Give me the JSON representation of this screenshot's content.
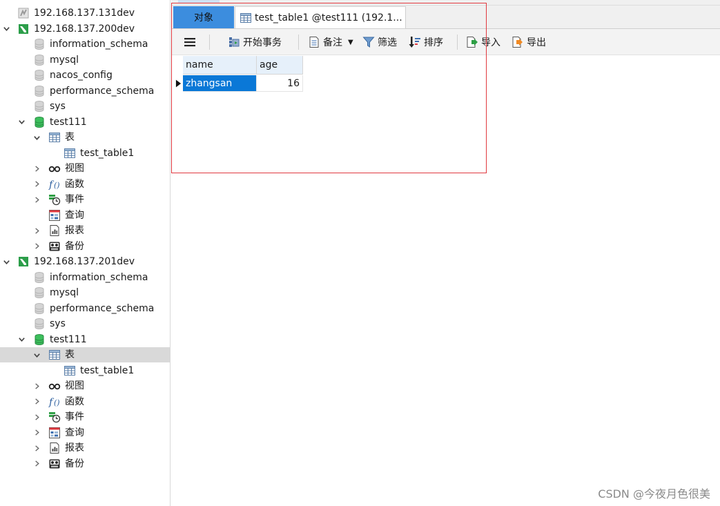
{
  "tree": [
    {
      "id": "conn-131",
      "label": "192.168.137.131dev",
      "icon": "connection-inactive-icon",
      "chevron": "none",
      "selected": false
    },
    {
      "id": "conn-200",
      "label": "192.168.137.200dev",
      "icon": "connection-active-icon",
      "chevron": "down",
      "selected": false
    },
    {
      "id": "db-information-schema-200",
      "label": "information_schema",
      "icon": "database-gray-icon",
      "chevron": "none",
      "selected": false
    },
    {
      "id": "db-mysql-200",
      "label": "mysql",
      "icon": "database-gray-icon",
      "chevron": "none",
      "selected": false
    },
    {
      "id": "db-nacos-config-200",
      "label": "nacos_config",
      "icon": "database-gray-icon",
      "chevron": "none",
      "selected": false
    },
    {
      "id": "db-performance-schema-200",
      "label": "performance_schema",
      "icon": "database-gray-icon",
      "chevron": "none",
      "selected": false
    },
    {
      "id": "db-sys-200",
      "label": "sys",
      "icon": "database-gray-icon",
      "chevron": "none",
      "selected": false
    },
    {
      "id": "db-test111-200",
      "label": "test111",
      "icon": "database-green-icon",
      "chevron": "down",
      "selected": false
    },
    {
      "id": "tables-200",
      "label": "表",
      "icon": "table-icon",
      "chevron": "down",
      "selected": false
    },
    {
      "id": "table-test-table1-200",
      "label": "test_table1",
      "icon": "table-icon",
      "chevron": "none",
      "selected": false
    },
    {
      "id": "views-200",
      "label": "视图",
      "icon": "view-glasses-icon",
      "chevron": "right",
      "selected": false
    },
    {
      "id": "functions-200",
      "label": "函数",
      "icon": "function-icon",
      "chevron": "right",
      "selected": false
    },
    {
      "id": "events-200",
      "label": "事件",
      "icon": "event-clock-icon",
      "chevron": "right",
      "selected": false
    },
    {
      "id": "queries-200",
      "label": "查询",
      "icon": "query-icon",
      "chevron": "none",
      "selected": false
    },
    {
      "id": "reports-200",
      "label": "报表",
      "icon": "report-icon",
      "chevron": "right",
      "selected": false
    },
    {
      "id": "backups-200",
      "label": "备份",
      "icon": "backup-icon",
      "chevron": "right",
      "selected": false
    },
    {
      "id": "conn-201",
      "label": "192.168.137.201dev",
      "icon": "connection-active-icon",
      "chevron": "down",
      "selected": false
    },
    {
      "id": "db-information-schema-201",
      "label": "information_schema",
      "icon": "database-gray-icon",
      "chevron": "none",
      "selected": false
    },
    {
      "id": "db-mysql-201",
      "label": "mysql",
      "icon": "database-gray-icon",
      "chevron": "none",
      "selected": false
    },
    {
      "id": "db-performance-schema-201",
      "label": "performance_schema",
      "icon": "database-gray-icon",
      "chevron": "none",
      "selected": false
    },
    {
      "id": "db-sys-201",
      "label": "sys",
      "icon": "database-gray-icon",
      "chevron": "none",
      "selected": false
    },
    {
      "id": "db-test111-201",
      "label": "test111",
      "icon": "database-green-icon",
      "chevron": "down",
      "selected": false
    },
    {
      "id": "tables-201",
      "label": "表",
      "icon": "table-icon",
      "chevron": "down",
      "selected": true
    },
    {
      "id": "table-test-table1-201",
      "label": "test_table1",
      "icon": "table-icon",
      "chevron": "none",
      "selected": false
    },
    {
      "id": "views-201",
      "label": "视图",
      "icon": "view-glasses-icon",
      "chevron": "right",
      "selected": false
    },
    {
      "id": "functions-201",
      "label": "函数",
      "icon": "function-icon",
      "chevron": "right",
      "selected": false
    },
    {
      "id": "events-201",
      "label": "事件",
      "icon": "event-clock-icon",
      "chevron": "right",
      "selected": false
    },
    {
      "id": "queries-201",
      "label": "查询",
      "icon": "query-icon",
      "chevron": "right",
      "selected": false
    },
    {
      "id": "reports-201",
      "label": "报表",
      "icon": "report-icon",
      "chevron": "right",
      "selected": false
    },
    {
      "id": "backups-201",
      "label": "备份",
      "icon": "backup-icon",
      "chevron": "right",
      "selected": false
    }
  ],
  "tabs": {
    "objects_label": "对象",
    "table_tab_label": "test_table1 @test111 (192.1..."
  },
  "toolbar": {
    "menu_icon": "hamburger-menu-icon",
    "begin_transaction_label": "开始事务",
    "notes_label": "备注",
    "filter_label": "筛选",
    "sort_label": "排序",
    "import_label": "导入",
    "export_label": "导出"
  },
  "grid": {
    "columns": [
      "name",
      "age"
    ],
    "rows": [
      [
        "zhangsan",
        "16"
      ]
    ]
  },
  "colors": {
    "active_tab": "#3c8dde",
    "selected_cell": "#0a78d7",
    "header_bg": "#e6f0fa",
    "green_db": "#2fa84f",
    "annotation_box": "#e0383e"
  },
  "watermark": "CSDN @今夜月色很美"
}
